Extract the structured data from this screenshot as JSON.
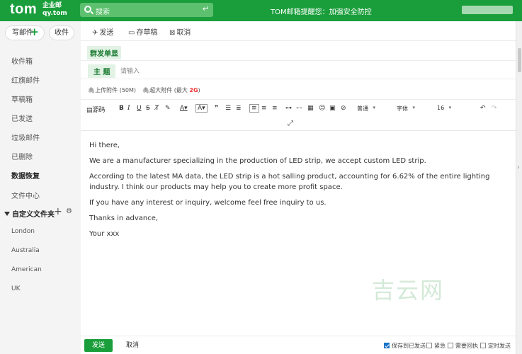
{
  "header": {
    "logo_text": "tom",
    "logo_sub_line1": "企业邮",
    "logo_sub_line2": "qy.tom",
    "search_placeholder": "搜索",
    "search_enter_glyph": "↵",
    "notice": "TOM邮箱提醒您：加强安全防控"
  },
  "sidebar": {
    "write_label": "写邮件",
    "receive_label": "收件",
    "items": [
      {
        "label": "收件箱"
      },
      {
        "label": "红旗邮件"
      },
      {
        "label": "草稿箱"
      },
      {
        "label": "已发送"
      },
      {
        "label": "垃圾邮件"
      },
      {
        "label": "已删除"
      },
      {
        "label": "数据恢复"
      },
      {
        "label": "文件中心"
      }
    ],
    "custom_folder_label": "自定义文件夹",
    "custom_folders": [
      {
        "label": "London"
      },
      {
        "label": "Australia"
      },
      {
        "label": "American"
      },
      {
        "label": "UK"
      }
    ]
  },
  "toolbar": {
    "send": "发送",
    "save_draft": "存草稿",
    "cancel": "取消"
  },
  "compose": {
    "group_send_label": "群发单显",
    "subject_label": "主 题",
    "subject_placeholder": "请输入",
    "attach_label": "上传附件 (50M)",
    "big_attach_label": "超大附件 (最大 ",
    "big_attach_size": "2G",
    "big_attach_close": ")"
  },
  "editor": {
    "source_label": "源码",
    "font_size_select": "普通",
    "font_family_select": "字体",
    "font_px_select": "16"
  },
  "body": {
    "lines": [
      "Hi there,",
      "We are a manufacturer specializing in the production of LED strip, we accept custom LED strip.",
      "According to the latest MA data, the LED strip is a hot salling product, accounting for 6.62% of the entire lighting industry. I think our products may help you to create more profit space.",
      "If you have any interest or inquiry, welcome feel free inquiry to us.",
      "Thanks in advance,",
      "Your xxx"
    ]
  },
  "watermark": "吉云网",
  "footer": {
    "send": "发送",
    "cancel": "取消",
    "options": [
      {
        "label": "保存到已发送",
        "checked": true
      },
      {
        "label": "紧急",
        "checked": false
      },
      {
        "label": "需要回执",
        "checked": false
      },
      {
        "label": "定时发送",
        "checked": false
      }
    ]
  },
  "colors": {
    "brand_green": "#1a9e3b",
    "chip_bg": "#e2f2e5",
    "warning_red": "#e33"
  }
}
